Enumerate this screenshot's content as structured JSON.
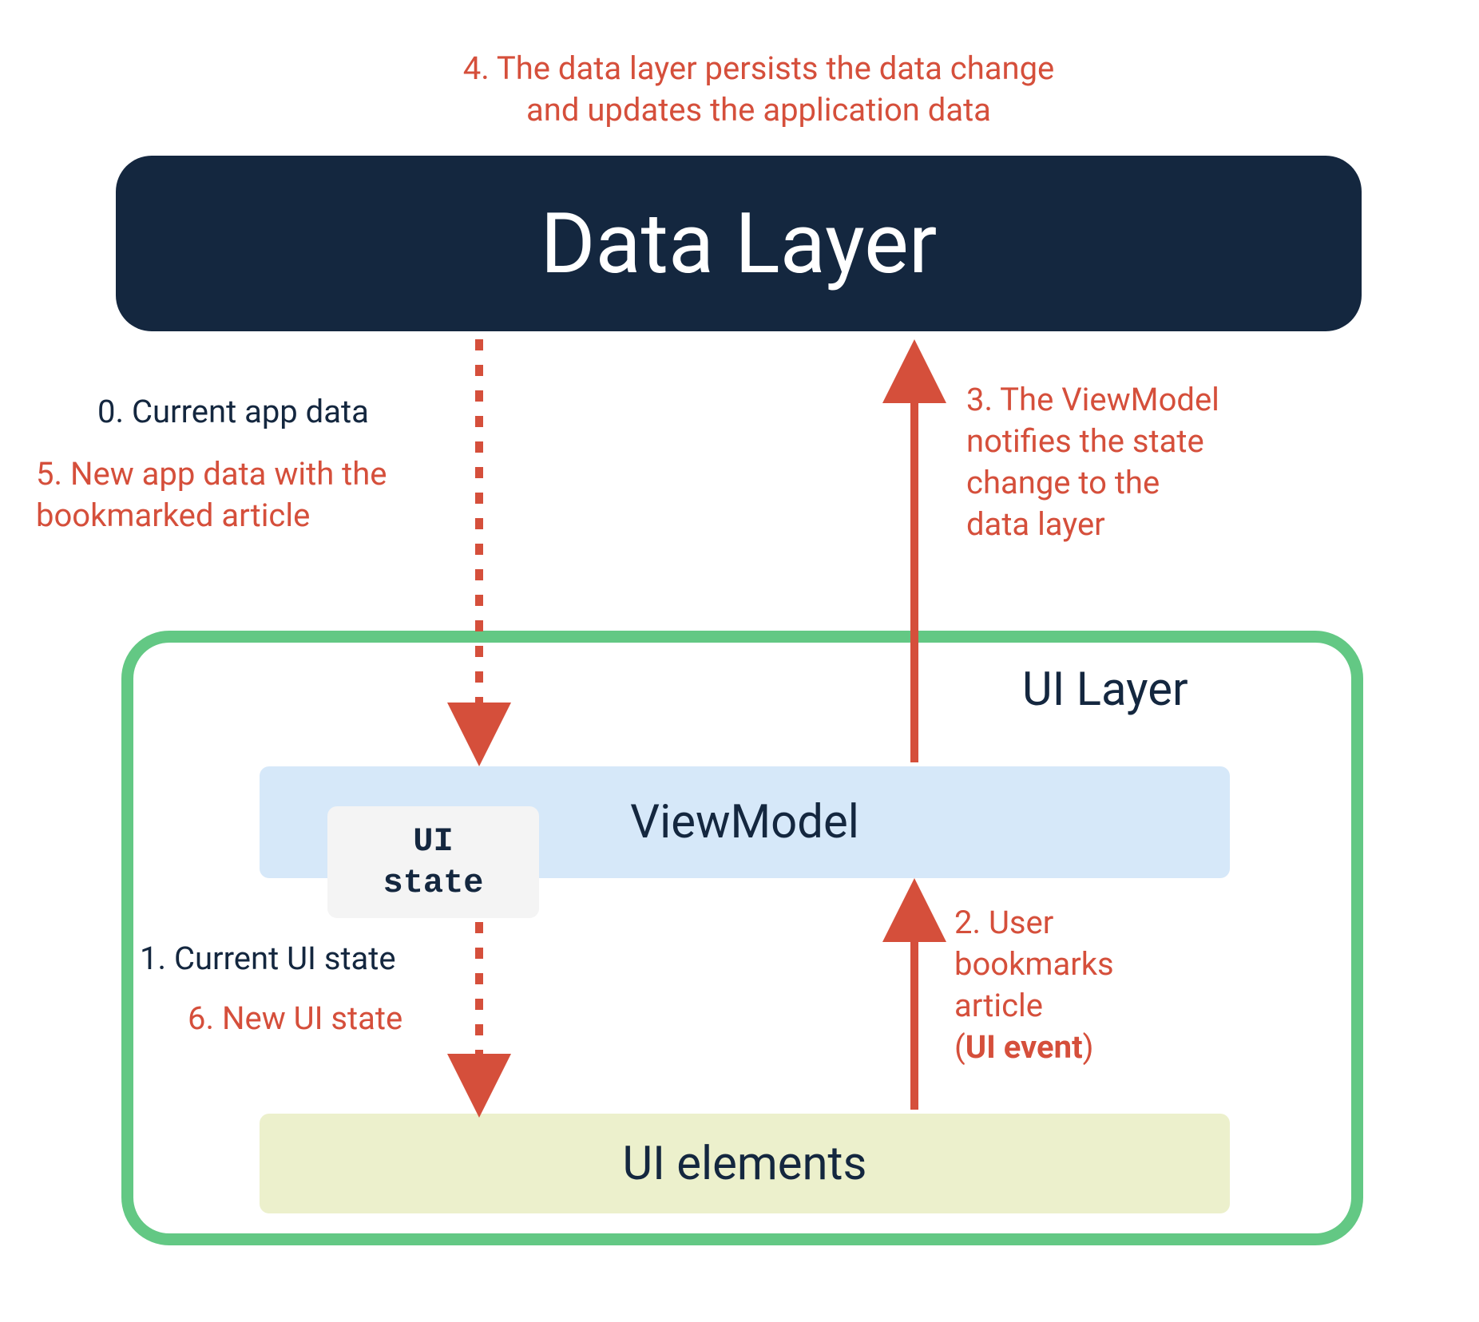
{
  "annotations": {
    "step4_line1": "4. The data layer persists the data change",
    "step4_line2": "and updates the application data",
    "step0": "0. Current app data",
    "step5_line1": "5. New app data with the",
    "step5_line2": "bookmarked article",
    "step3_line1": "3. The ViewModel",
    "step3_line2": "notifies the state",
    "step3_line3": "change to the",
    "step3_line4": "data layer",
    "step1": "1. Current UI state",
    "step6": "6. New UI state",
    "step2_line1": "2. User",
    "step2_line2": "bookmarks",
    "step2_line3": "article",
    "step2_line4a": "(",
    "step2_line4b": "UI event",
    "step2_line4c": ")"
  },
  "boxes": {
    "data_layer": "Data Layer",
    "ui_layer": "UI Layer",
    "viewmodel": "ViewModel",
    "ui_state": "UI\nstate",
    "ui_elements": "UI elements"
  },
  "colors": {
    "red": "#d54f3b",
    "navy": "#14273f",
    "green": "#63c884",
    "lightblue": "#d6e8f9",
    "lightgreen": "#ecf0cc",
    "lightgray": "#f4f4f4"
  }
}
